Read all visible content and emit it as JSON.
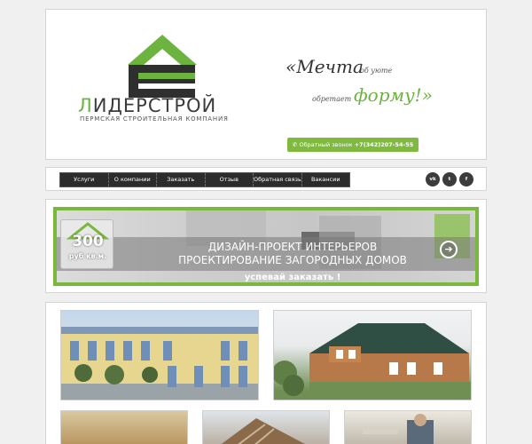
{
  "header": {
    "logo_name_first": "Л",
    "logo_name_rest": "ИДЕРСТРОЙ",
    "logo_sub": "ПЕРМСКАЯ СТРОИТЕЛЬНАЯ КОМПАНИЯ",
    "slogan": {
      "part1": "«Мечта",
      "part2": "об уюте",
      "part3": "обретает",
      "part4": "форму!»"
    },
    "callback": {
      "icon": "phone-icon",
      "label": "Обратный звонок",
      "phone": "+7(342)207-54-55"
    }
  },
  "nav": {
    "items": [
      "Услуги",
      "О компании",
      "Заказать",
      "Отзыв",
      "Обратная связь",
      "Вакансии"
    ]
  },
  "social": [
    {
      "name": "vk-icon",
      "label": "vk"
    },
    {
      "name": "twitter-icon",
      "label": "t"
    },
    {
      "name": "facebook-icon",
      "label": "f"
    }
  ],
  "banner": {
    "price_value": "300",
    "price_unit": "руб кв.м.",
    "line1": "ДИЗАЙН-ПРОЕКТ ИНТЕРЬЕРОВ",
    "line2": "ПРОЕКТИРОВАНИЕ ЗАГОРОДНЫХ ДОМОВ",
    "cta": "успевай заказать !",
    "arrow_icon": "arrow-right-icon"
  },
  "colors": {
    "brand_green": "#6db33f",
    "nav_bg": "#2c2c2c",
    "logo_dark": "#2f2f2f"
  }
}
